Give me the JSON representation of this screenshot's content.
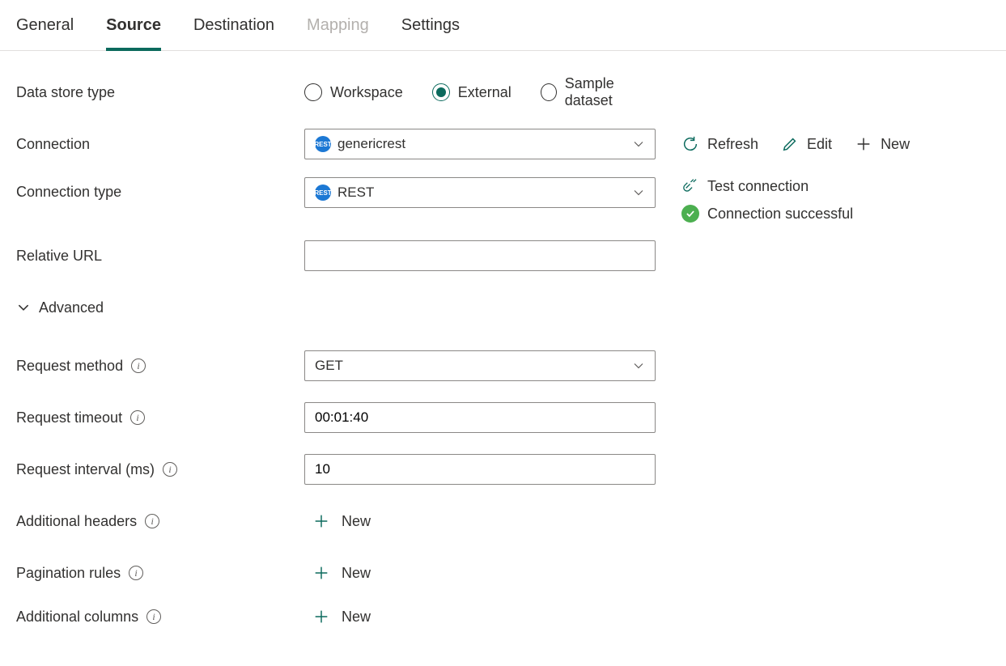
{
  "tabs": {
    "general": "General",
    "source": "Source",
    "destination": "Destination",
    "mapping": "Mapping",
    "settings": "Settings"
  },
  "labels": {
    "data_store_type": "Data store type",
    "connection": "Connection",
    "connection_type": "Connection type",
    "relative_url": "Relative URL",
    "advanced": "Advanced",
    "request_method": "Request method",
    "request_timeout": "Request timeout",
    "request_interval": "Request interval (ms)",
    "additional_headers": "Additional headers",
    "pagination_rules": "Pagination rules",
    "additional_columns": "Additional columns"
  },
  "data_store_type": {
    "options": {
      "workspace": "Workspace",
      "external": "External",
      "sample_dataset": "Sample dataset"
    },
    "selected": "external"
  },
  "connection": {
    "value": "genericrest"
  },
  "connection_type": {
    "value": "REST"
  },
  "connection_actions": {
    "refresh": "Refresh",
    "edit": "Edit",
    "new": "New"
  },
  "test_connection": {
    "label": "Test connection",
    "status_text": "Connection successful"
  },
  "relative_url": {
    "value": ""
  },
  "request_method": {
    "value": "GET"
  },
  "request_timeout": {
    "value": "00:01:40"
  },
  "request_interval": {
    "value": "10"
  },
  "buttons": {
    "new": "New"
  }
}
